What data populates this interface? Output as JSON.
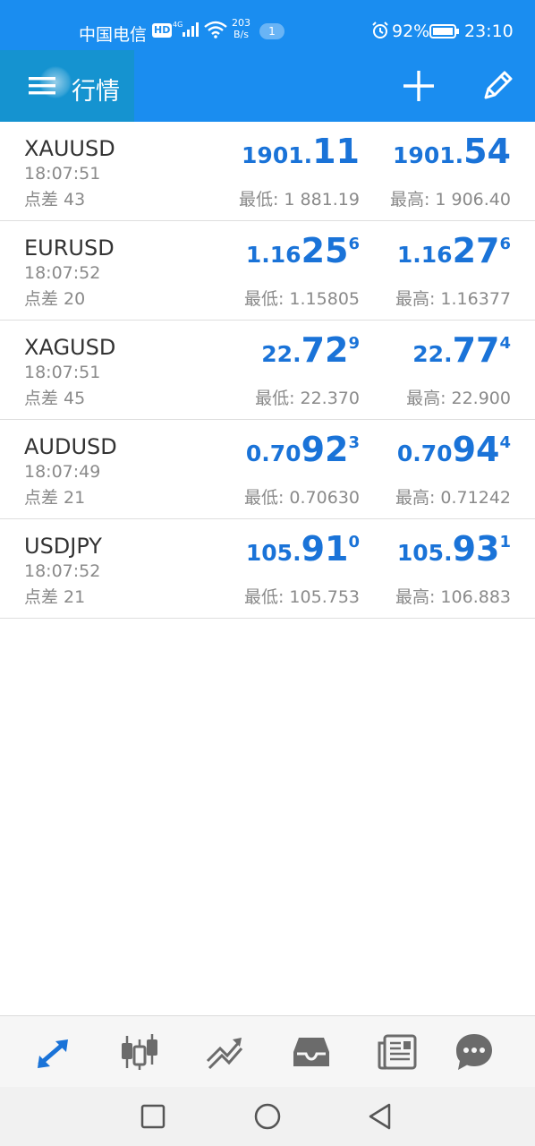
{
  "status_bar": {
    "carrier": "中国电信",
    "hd_badge": "HD",
    "net_speed_value": "203",
    "net_speed_unit": "B/s",
    "notification_count": "1",
    "battery_percent": "92%",
    "time": "23:10"
  },
  "app_bar": {
    "title": "行情",
    "icons": [
      "menu-icon",
      "plus-icon",
      "pencil-icon"
    ]
  },
  "quotes": [
    {
      "symbol": "XAUUSD",
      "time": "18:07:51",
      "spread": "点差 43",
      "bid": {
        "small": "1901.",
        "big": "11",
        "sup": ""
      },
      "ask": {
        "small": "1901.",
        "big": "54",
        "sup": ""
      },
      "low": "最低: 1 881.19",
      "high": "最高: 1 906.40"
    },
    {
      "symbol": "EURUSD",
      "time": "18:07:52",
      "spread": "点差 20",
      "bid": {
        "small": "1.16",
        "big": "25",
        "sup": "6"
      },
      "ask": {
        "small": "1.16",
        "big": "27",
        "sup": "6"
      },
      "low": "最低: 1.15805",
      "high": "最高: 1.16377"
    },
    {
      "symbol": "XAGUSD",
      "time": "18:07:51",
      "spread": "点差 45",
      "bid": {
        "small": "22.",
        "big": "72",
        "sup": "9"
      },
      "ask": {
        "small": "22.",
        "big": "77",
        "sup": "4"
      },
      "low": "最低: 22.370",
      "high": "最高: 22.900"
    },
    {
      "symbol": "AUDUSD",
      "time": "18:07:49",
      "spread": "点差 21",
      "bid": {
        "small": "0.70",
        "big": "92",
        "sup": "3"
      },
      "ask": {
        "small": "0.70",
        "big": "94",
        "sup": "4"
      },
      "low": "最低: 0.70630",
      "high": "最高: 0.71242"
    },
    {
      "symbol": "USDJPY",
      "time": "18:07:52",
      "spread": "点差 21",
      "bid": {
        "small": "105.",
        "big": "91",
        "sup": "0"
      },
      "ask": {
        "small": "105.",
        "big": "93",
        "sup": "1"
      },
      "low": "最低: 105.753",
      "high": "最高: 106.883"
    }
  ],
  "bottom_nav": {
    "items": [
      "quotes-arrows-icon",
      "candlestick-chart-icon",
      "trade-line-icon",
      "history-inbox-icon",
      "news-icon",
      "chat-icon"
    ],
    "active_color": "#1a73d8",
    "inactive_color": "#6b6b6b"
  },
  "system_nav": [
    "square-recents-icon",
    "circle-home-icon",
    "triangle-back-icon"
  ],
  "colors": {
    "header_blue": "#1a8df0",
    "price_blue": "#1a73d8"
  }
}
